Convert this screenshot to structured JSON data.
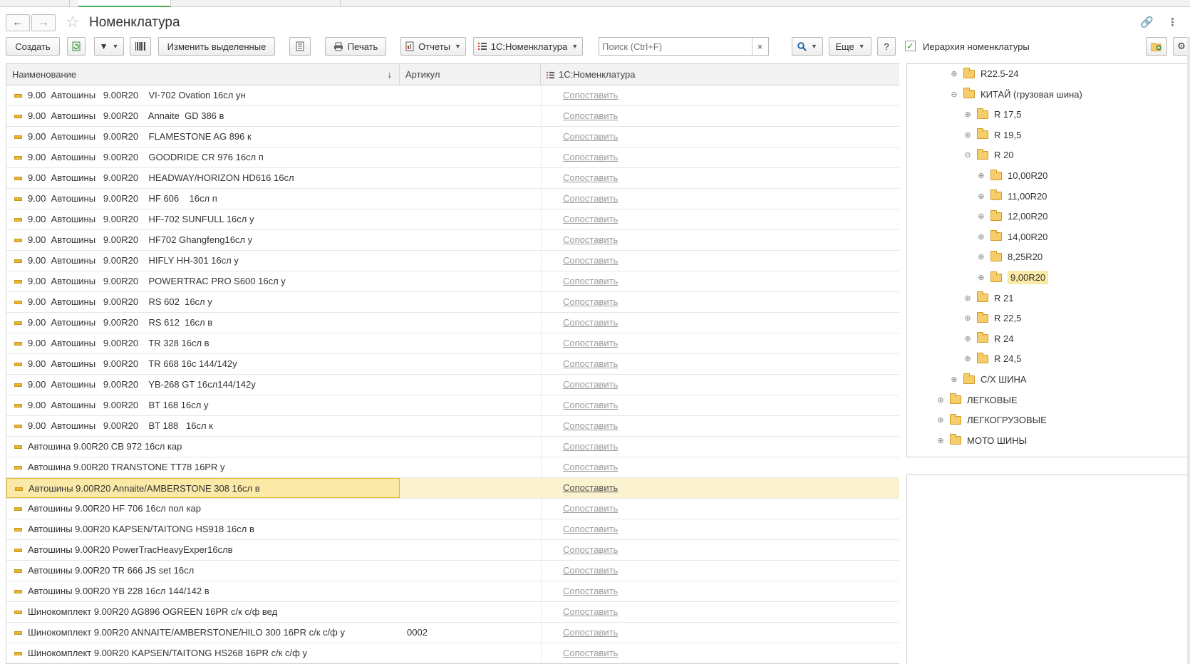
{
  "header": {
    "title": "Номенклатура"
  },
  "toolbar": {
    "create_label": "Создать",
    "edit_selected_label": "Изменить выделенные",
    "print_label": "Печать",
    "reports_label": "Отчеты",
    "nomenclature_1c_label": "1С:Номенклатура",
    "search_placeholder": "Поиск (Ctrl+F)",
    "clear_symbol": "×",
    "more_label": "Еще",
    "help_label": "?",
    "hierarchy_label": "Иерархия номенклатуры",
    "hierarchy_checked": true
  },
  "table": {
    "columns": {
      "name": "Наименование",
      "article": "Артикул",
      "nomenclature": "1С:Номенклатура",
      "sort_icon": "↓"
    },
    "rows": [
      {
        "name": "9.00  Автошины   9.00R20    VI-702 Ovation 16сл ун",
        "article": "",
        "action": "Сопоставить"
      },
      {
        "name": "9.00  Автошины   9.00R20    Annaite  GD 386 в",
        "article": "",
        "action": "Сопоставить"
      },
      {
        "name": "9.00  Автошины   9.00R20    FLAMESTONE AG 896 к",
        "article": "",
        "action": "Сопоставить"
      },
      {
        "name": "9.00  Автошины   9.00R20    GOODRIDE CR 976 16сл п",
        "article": "",
        "action": "Сопоставить"
      },
      {
        "name": "9.00  Автошины   9.00R20    HEADWAY/HORIZON HD616 16сл",
        "article": "",
        "action": "Сопоставить"
      },
      {
        "name": "9.00  Автошины   9.00R20    HF 606    16сл п",
        "article": "",
        "action": "Сопоставить"
      },
      {
        "name": "9.00  Автошины   9.00R20    HF-702 SUNFULL 16сл у",
        "article": "",
        "action": "Сопоставить"
      },
      {
        "name": "9.00  Автошины   9.00R20    HF702 Ghangfeng16сл у",
        "article": "",
        "action": "Сопоставить"
      },
      {
        "name": "9.00  Автошины   9.00R20    HIFLY HH-301 16сл у",
        "article": "",
        "action": "Сопоставить"
      },
      {
        "name": "9.00  Автошины   9.00R20    POWERTRAC PRO S600 16сл у",
        "article": "",
        "action": "Сопоставить"
      },
      {
        "name": "9.00  Автошины   9.00R20    RS 602  16сл у",
        "article": "",
        "action": "Сопоставить"
      },
      {
        "name": "9.00  Автошины   9.00R20    RS 612  16сл в",
        "article": "",
        "action": "Сопоставить"
      },
      {
        "name": "9.00  Автошины   9.00R20    TR 328 16сл в",
        "article": "",
        "action": "Сопоставить"
      },
      {
        "name": "9.00  Автошины   9.00R20    TR 668 16с 144/142у",
        "article": "",
        "action": "Сопоставить"
      },
      {
        "name": "9.00  Автошины   9.00R20    YB-268 GT 16сл144/142у",
        "article": "",
        "action": "Сопоставить"
      },
      {
        "name": "9.00  Автошины   9.00R20    BT 168 16сл у",
        "article": "",
        "action": "Сопоставить"
      },
      {
        "name": "9.00  Автошины   9.00R20    BT 188   16сл к",
        "article": "",
        "action": "Сопоставить"
      },
      {
        "name": "Автошина 9.00R20 CB 972 16сл кар",
        "article": "",
        "action": "Сопоставить"
      },
      {
        "name": "Автошина 9.00R20 TRANSTONE TT78 16PR у",
        "article": "",
        "action": "Сопоставить"
      },
      {
        "name": "Автошины 9.00R20 Annaite/AMBERSTONE 308 16сл в",
        "article": "",
        "action": "Сопоставить",
        "selected": true
      },
      {
        "name": "Автошины 9.00R20 HF 706 16сл пол кар",
        "article": "",
        "action": "Сопоставить"
      },
      {
        "name": "Автошины 9.00R20 KAPSEN/TAITONG HS918 16сл в",
        "article": "",
        "action": "Сопоставить"
      },
      {
        "name": "Автошины 9.00R20 PowerTracHeavyExper16слв",
        "article": "",
        "action": "Сопоставить"
      },
      {
        "name": "Автошины 9.00R20 TR 666 JS set 16сл",
        "article": "",
        "action": "Сопоставить"
      },
      {
        "name": "Автошины 9.00R20 YB 228 16сл 144/142 в",
        "article": "",
        "action": "Сопоставить"
      },
      {
        "name": "Шинокомплект 9.00R20 AG896 OGREEN 16PR с/к с/ф вед",
        "article": "",
        "action": "Сопоставить"
      },
      {
        "name": "Шинокомплект 9.00R20 ANNAITE/AMBERSTONE/HILO 300 16PR с/к с/ф у",
        "article": "0002",
        "action": "Сопоставить"
      },
      {
        "name": "Шинокомплект 9.00R20 KAPSEN/TAITONG HS268 16PR с/к с/ф у",
        "article": "",
        "action": "Сопоставить"
      }
    ]
  },
  "tree": {
    "nodes": [
      {
        "label": "R22.5-24",
        "level": 2,
        "expander": "⊕"
      },
      {
        "label": "КИТАЙ  (грузовая шина)",
        "level": 2,
        "expander": "⊖"
      },
      {
        "label": "R 17,5",
        "level": 3,
        "expander": "⊕"
      },
      {
        "label": "R 19,5",
        "level": 3,
        "expander": "⊕"
      },
      {
        "label": "R 20",
        "level": 3,
        "expander": "⊖"
      },
      {
        "label": "10,00R20",
        "level": 4,
        "expander": "⊕"
      },
      {
        "label": "11,00R20",
        "level": 4,
        "expander": "⊕"
      },
      {
        "label": "12,00R20",
        "level": 4,
        "expander": "⊕"
      },
      {
        "label": "14,00R20",
        "level": 4,
        "expander": "⊕"
      },
      {
        "label": "8,25R20",
        "level": 4,
        "expander": "⊕"
      },
      {
        "label": "9,00R20",
        "level": 4,
        "expander": "⊕",
        "selected": true
      },
      {
        "label": "R 21",
        "level": 3,
        "expander": "⊕"
      },
      {
        "label": "R 22,5",
        "level": 3,
        "expander": "⊕"
      },
      {
        "label": "R 24",
        "level": 3,
        "expander": "⊕"
      },
      {
        "label": "R 24,5",
        "level": 3,
        "expander": "⊕"
      },
      {
        "label": "С/Х ШИНА",
        "level": 2,
        "expander": "⊕"
      },
      {
        "label": "ЛЕГКОВЫЕ",
        "level": 1,
        "expander": "⊕"
      },
      {
        "label": "ЛЕГКОГРУЗОВЫЕ",
        "level": 1,
        "expander": "⊕"
      },
      {
        "label": "МОТО ШИНЫ",
        "level": 1,
        "expander": "⊕"
      }
    ]
  },
  "colors": {
    "accent_green": "#4caf50",
    "selection_fill": "#fbe9a8",
    "selection_border": "#e8b623",
    "folder": "#f5cd6a"
  }
}
